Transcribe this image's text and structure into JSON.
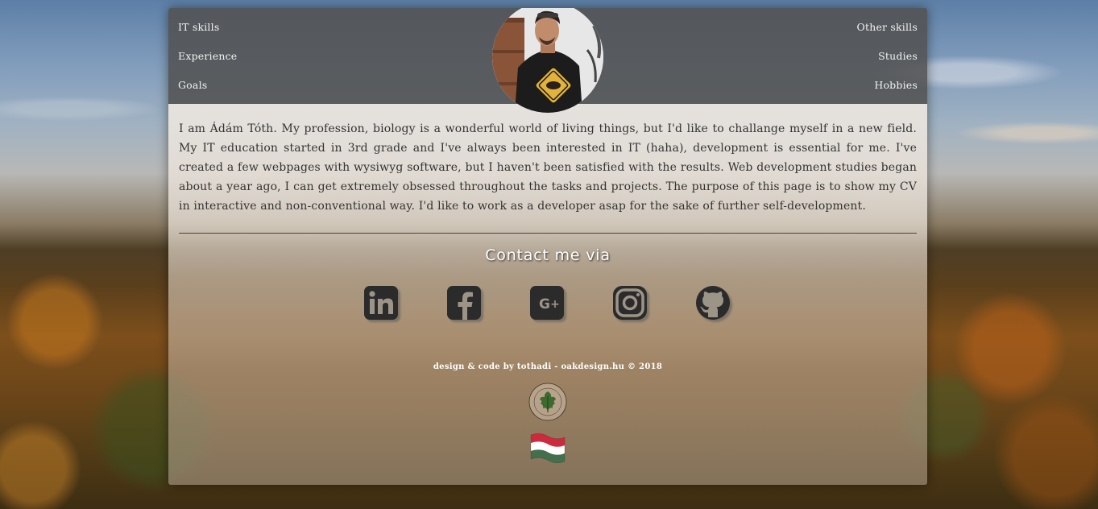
{
  "nav": {
    "left": [
      "IT skills",
      "Experience",
      "Goals"
    ],
    "right": [
      "Other skills",
      "Studies",
      "Hobbies"
    ]
  },
  "intro": {
    "text": "I am Ádám Tóth. My profession, biology is a wonderful world of living things, but I'd like to challange myself in a new field. My IT education started in 3rd grade and I've always been interested in IT (haha), development is essential for me. I've created a few webpages with wysiwyg software, but I haven't been satisfied with the results. Web development studies began about a year ago, I can get extremely obsessed throughout the tasks and projects. The purpose of this page is to show my CV in interactive and non-conventional way. I'd like to work as a developer asap for the sake of further self-development."
  },
  "contact": {
    "title": "Contact me via",
    "icons": [
      "linkedin-icon",
      "facebook-icon",
      "google-plus-icon",
      "instagram-icon",
      "github-icon"
    ]
  },
  "footer": {
    "credit": "design & code by tothadi - oakdesign.hu © 2018",
    "logo": "oak-design-logo",
    "logo_text": "OAK DESIGN STUDIO",
    "flag": "hungarian-flag-icon"
  },
  "colors": {
    "header_bg": "#525252",
    "icon_color": "#2b2b2b",
    "flag_red": "#cd2a3e",
    "flag_white": "#ffffff",
    "flag_green": "#436f4d"
  }
}
